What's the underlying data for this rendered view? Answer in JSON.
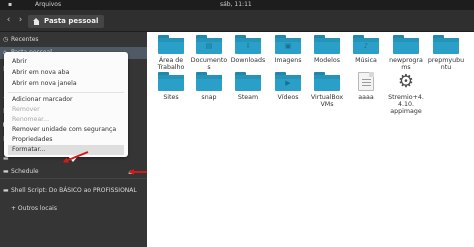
{
  "topbar": {
    "app_name": "Arquivos",
    "clock": "sáb, 11:11"
  },
  "toolbar": {
    "back_icon": "chevron-left-icon",
    "forward_icon": "chevron-right-icon",
    "path_label": "Pasta pessoal"
  },
  "sidebar": {
    "items": [
      {
        "label": "Recentes",
        "icon": "clock-icon"
      },
      {
        "label": "Pasta pessoal",
        "icon": "home-icon"
      },
      {
        "label": "",
        "icon": "document-icon"
      },
      {
        "label": "",
        "icon": "download-icon"
      },
      {
        "label": "",
        "icon": "music-icon"
      },
      {
        "label": "",
        "icon": "image-icon"
      },
      {
        "label": "",
        "icon": "video-icon"
      },
      {
        "label": "",
        "icon": "trash-icon"
      },
      {
        "label": "",
        "icon": "drive-icon"
      },
      {
        "label": "Schedule",
        "icon": "drive-icon"
      },
      {
        "label": "Shell Script: Do BÁSICO ao PROFISSIONAL",
        "icon": "drive-icon"
      },
      {
        "label": "+ Outros locais",
        "icon": "plus-icon"
      }
    ]
  },
  "context_menu": {
    "items": [
      {
        "label": "Abrir",
        "disabled": false
      },
      {
        "label": "Abrir em nova aba",
        "disabled": false
      },
      {
        "label": "Abrir em nova janela",
        "disabled": false
      },
      {
        "label": "Adicionar marcador",
        "disabled": false
      },
      {
        "label": "Remover",
        "disabled": true
      },
      {
        "label": "Renomear...",
        "disabled": true
      },
      {
        "label": "Remover unidade com segurança",
        "disabled": false
      },
      {
        "label": "Propriedades",
        "disabled": false
      },
      {
        "label": "Formatar...",
        "disabled": false
      }
    ]
  },
  "files": [
    {
      "name": "Área de",
      "name2": "Trabalho",
      "kind": "folder",
      "glyph": ""
    },
    {
      "name": "Documento",
      "name2": "s",
      "kind": "folder",
      "glyph": "▤"
    },
    {
      "name": "Downloads",
      "name2": "",
      "kind": "folder",
      "glyph": "⇩"
    },
    {
      "name": "Imagens",
      "name2": "",
      "kind": "folder",
      "glyph": "▣"
    },
    {
      "name": "Modelos",
      "name2": "",
      "kind": "folder",
      "glyph": ""
    },
    {
      "name": "Música",
      "name2": "",
      "kind": "folder",
      "glyph": "♪"
    },
    {
      "name": "newprogra",
      "name2": "ms",
      "kind": "folder",
      "glyph": ""
    },
    {
      "name": "prepmyubu",
      "name2": "ntu",
      "kind": "folder",
      "glyph": ""
    },
    {
      "name": "Sites",
      "name2": "",
      "kind": "folder",
      "glyph": ""
    },
    {
      "name": "snap",
      "name2": "",
      "kind": "folder",
      "glyph": ""
    },
    {
      "name": "Steam",
      "name2": "",
      "kind": "folder",
      "glyph": ""
    },
    {
      "name": "Vídeos",
      "name2": "",
      "kind": "folder",
      "glyph": "▶"
    },
    {
      "name": "VirtualBox",
      "name2": "VMs",
      "kind": "folder",
      "glyph": ""
    },
    {
      "name": "aaaa",
      "name2": "",
      "kind": "document",
      "glyph": ""
    },
    {
      "name": "Stremio+4.",
      "name2": "4.10.",
      "name3": "appimage",
      "kind": "executable",
      "glyph": ""
    }
  ],
  "colors": {
    "folder": "#2aa0c8",
    "sidebar_bg": "#353535",
    "highlight": "#d11a1a"
  }
}
